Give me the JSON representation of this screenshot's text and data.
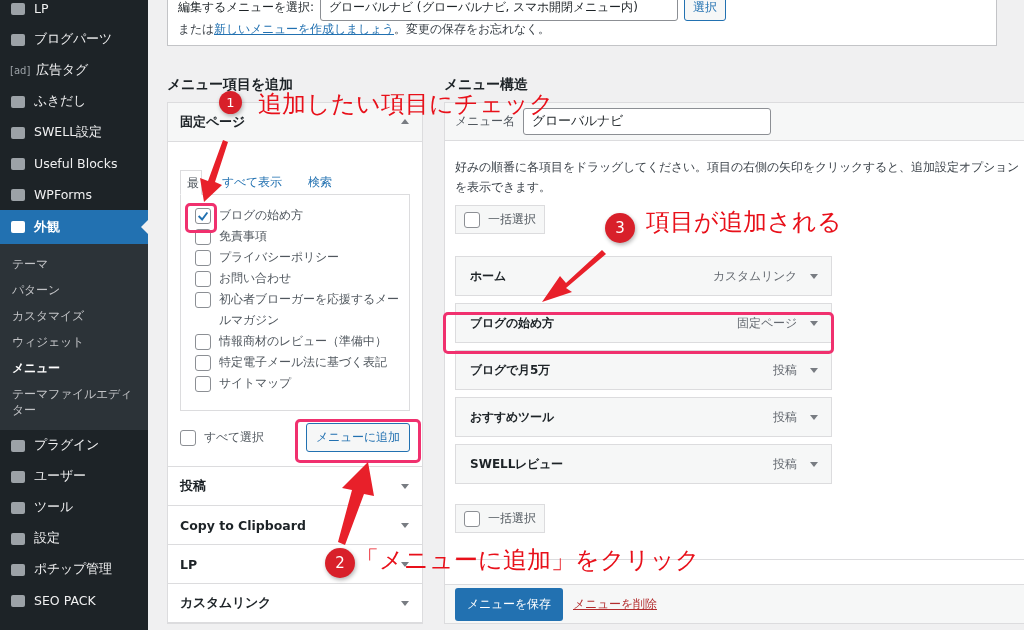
{
  "sidebar": {
    "items": [
      {
        "label": "LP",
        "selected": false
      },
      {
        "label": "ブログパーツ",
        "selected": false
      },
      {
        "label": "広告タグ",
        "icon_text": "[ad]",
        "selected": false
      },
      {
        "label": "ふきだし",
        "selected": false
      },
      {
        "label": "SWELL設定",
        "selected": false
      },
      {
        "label": "Useful Blocks",
        "selected": false
      },
      {
        "label": "WPForms",
        "selected": false
      },
      {
        "label": "外観",
        "selected": true,
        "children": [
          {
            "label": "テーマ",
            "selected": false
          },
          {
            "label": "パターン",
            "selected": false
          },
          {
            "label": "カスタマイズ",
            "selected": false
          },
          {
            "label": "ウィジェット",
            "selected": false
          },
          {
            "label": "メニュー",
            "selected": true
          },
          {
            "label": "テーマファイルエディター",
            "selected": false
          }
        ]
      },
      {
        "label": "プラグイン",
        "selected": false
      },
      {
        "label": "ユーザー",
        "selected": false
      },
      {
        "label": "ツール",
        "selected": false
      },
      {
        "label": "設定",
        "selected": false
      },
      {
        "label": "ポチップ管理",
        "selected": false
      },
      {
        "label": "SEO PACK",
        "selected": false
      }
    ]
  },
  "menu_select": {
    "label": "編集するメニューを選択:",
    "value": "グローバルナビ (グローバルナビ, スマホ開閉メニュー内)",
    "button": "選択",
    "note_prefix": "または",
    "note_link": "新しいメニューを作成しましょう",
    "note_suffix": "。変更の保存をお忘れなく。"
  },
  "add_items": {
    "heading": "メニュー項目を追加",
    "sections": [
      {
        "title": "固定ページ",
        "expanded": true,
        "tabs": [
          {
            "label": "最",
            "selected": true
          },
          {
            "label": "すべて表示",
            "selected": false
          },
          {
            "label": "検索",
            "selected": false
          }
        ],
        "items": [
          {
            "label": "ブログの始め方",
            "checked": true
          },
          {
            "label": "免責事項",
            "checked": false
          },
          {
            "label": "プライバシーポリシー",
            "checked": false
          },
          {
            "label": "お問い合わせ",
            "checked": false
          },
          {
            "label": "初心者ブローガーを応援するメールマガジン",
            "checked": false
          },
          {
            "label": "情報商材のレビュー（準備中）",
            "checked": false
          },
          {
            "label": "特定電子メール法に基づく表記",
            "checked": false
          },
          {
            "label": "サイトマップ",
            "checked": false
          }
        ],
        "select_all": {
          "label": "すべて選択",
          "checked": false
        },
        "button": "メニューに追加"
      },
      {
        "title": "投稿",
        "expanded": false
      },
      {
        "title": "Copy to Clipboard",
        "expanded": false
      },
      {
        "title": "LP",
        "expanded": false
      },
      {
        "title": "カスタムリンク",
        "expanded": false
      }
    ]
  },
  "structure": {
    "heading": "メニュー構造",
    "name_label": "メニュー名",
    "name_value": "グローバルナビ",
    "instructions": "好みの順番に各項目をドラッグしてください。項目の右側の矢印をクリックすると、追加設定オプションを表示できます。",
    "bulk_top": {
      "label": "一括選択",
      "checked": false
    },
    "items": [
      {
        "title": "ホーム",
        "type": "カスタムリンク"
      },
      {
        "title": "ブログの始め方",
        "type": "固定ページ"
      },
      {
        "title": "ブログで月5万",
        "type": "投稿"
      },
      {
        "title": "おすすめツール",
        "type": "投稿"
      },
      {
        "title": "SWELLレビュー",
        "type": "投稿"
      }
    ],
    "bulk_bottom": {
      "label": "一括選択",
      "checked": false
    },
    "save_button": "メニューを保存",
    "delete_link": "メニューを削除"
  },
  "annotations": [
    {
      "number": "1",
      "text": "追加したい項目にチェック"
    },
    {
      "number": "2",
      "text": "「メニューに追加」をクリック"
    },
    {
      "number": "3",
      "text": "項目が追加される"
    }
  ]
}
